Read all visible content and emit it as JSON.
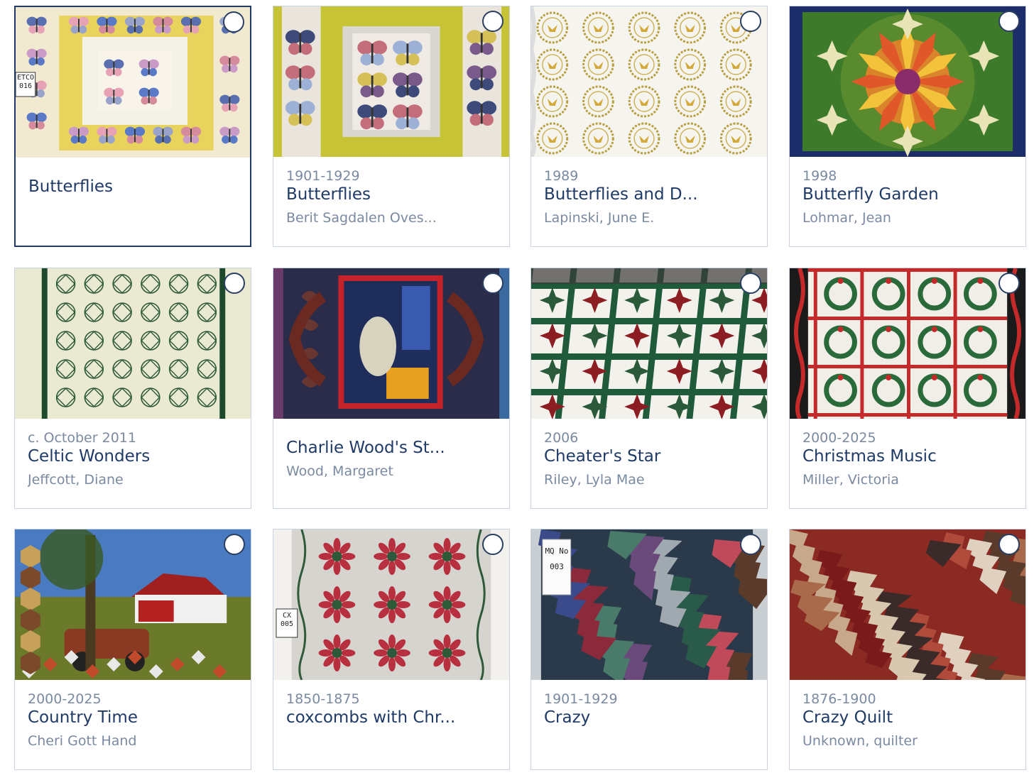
{
  "cards": [
    {
      "date": "",
      "title": "Butterflies",
      "maker": "",
      "selected": true,
      "thumb": "butterfly-white"
    },
    {
      "date": "1901-1929",
      "title": "Butterflies",
      "maker": "Berit Sagdalen Oves...",
      "selected": false,
      "thumb": "butterfly-yellow"
    },
    {
      "date": "1989",
      "title": "Butterflies and D...",
      "maker": "Lapinski, June E.",
      "selected": false,
      "thumb": "circles"
    },
    {
      "date": "1998",
      "title": "Butterfly Garden",
      "maker": "Lohmar, Jean",
      "selected": false,
      "thumb": "mandala"
    },
    {
      "date": "c. October 2011",
      "title": "Celtic Wonders",
      "maker": "Jeffcott, Diane",
      "selected": false,
      "thumb": "celtic"
    },
    {
      "date": "",
      "title": "Charlie Wood's St...",
      "maker": "Wood, Margaret",
      "selected": false,
      "thumb": "charlie"
    },
    {
      "date": "2006",
      "title": "Cheater's Star",
      "maker": "Riley, Lyla Mae",
      "selected": false,
      "thumb": "stars"
    },
    {
      "date": "2000-2025",
      "title": "Christmas Music",
      "maker": "Miller, Victoria",
      "selected": false,
      "thumb": "christmas"
    },
    {
      "date": "2000-2025",
      "title": "Country Time",
      "maker": "Cheri Gott Hand",
      "selected": false,
      "thumb": "country"
    },
    {
      "date": "1850-1875",
      "title": "coxcombs with Chr...",
      "maker": "",
      "selected": false,
      "thumb": "coxcomb"
    },
    {
      "date": "1901-1929",
      "title": "Crazy",
      "maker": "",
      "selected": false,
      "thumb": "crazy-blue"
    },
    {
      "date": "1876-1900",
      "title": "Crazy Quilt",
      "maker": "Unknown, quilter",
      "selected": false,
      "thumb": "crazy-red"
    }
  ],
  "thumb_labels": {
    "butterfly-white": [
      "ETCO",
      "016"
    ],
    "coxcomb": [
      "CX",
      "005"
    ],
    "crazy-blue": [
      "MQ No",
      "003"
    ]
  },
  "colors": {
    "title": "#1f3a66",
    "muted": "#7a8aa0",
    "border": "#c9d4e0",
    "selected_border": "#1f3a66"
  }
}
